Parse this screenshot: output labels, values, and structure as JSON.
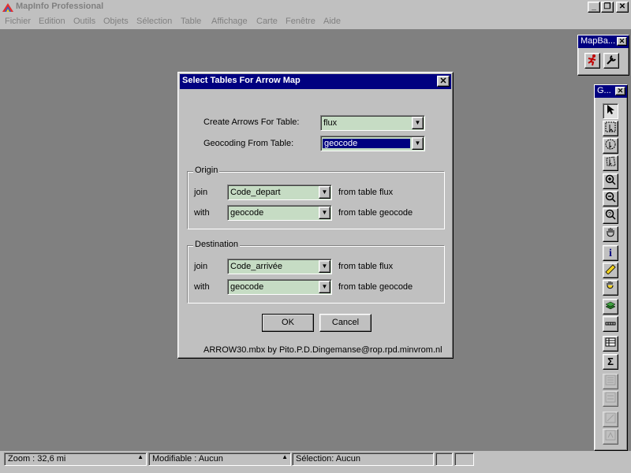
{
  "app": {
    "title": "MapInfo Professional"
  },
  "window_controls": {
    "minimize": "_",
    "restore": "❐",
    "close": "✕"
  },
  "menu": [
    "Fichier",
    "Edition",
    "Outils",
    "Objets",
    "Sélection",
    "Table",
    "Affichage",
    "Carte",
    "Fenêtre",
    "Aide"
  ],
  "mapbasic_palette": {
    "title": "MapBa..."
  },
  "main_palette": {
    "title": "G..."
  },
  "dialog": {
    "title": "Select Tables For Arrow Map",
    "create_arrows_label": "Create Arrows For Table:",
    "create_arrows_value": "flux",
    "geocoding_label": "Geocoding From Table:",
    "geocoding_value": "geocode",
    "origin": {
      "title": "Origin",
      "join_label": "join",
      "join_value": "Code_depart",
      "join_from": "from table flux",
      "with_label": "with",
      "with_value": "geocode",
      "with_from": "from table geocode"
    },
    "destination": {
      "title": "Destination",
      "join_label": "join",
      "join_value": "Code_arrivée",
      "join_from": "from table flux",
      "with_label": "with",
      "with_value": "geocode",
      "with_from": "from table geocode"
    },
    "ok_label": "OK",
    "cancel_label": "Cancel",
    "footer": "ARROW30.mbx by Pito.P.D.Dingemanse@rop.rpd.minvrom.nl"
  },
  "status": {
    "zoom": "Zoom : 32,6 mi",
    "modifiable": "Modifiable : Aucun",
    "selection": "Sélection: Aucun"
  },
  "colors": {
    "title_active": "#000080",
    "combo_bg": "#c6dcc4",
    "desktop": "#808080",
    "face": "#c0c0c0"
  }
}
